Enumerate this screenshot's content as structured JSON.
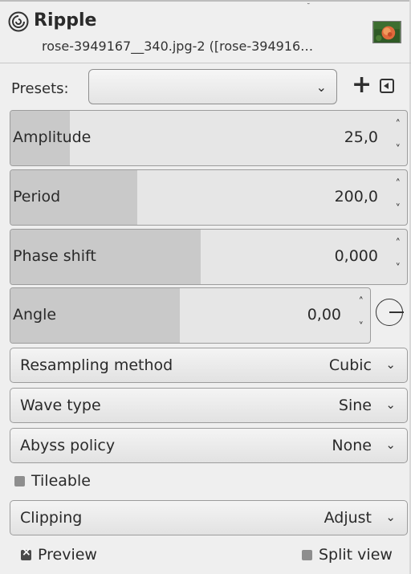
{
  "header": {
    "title": "Ripple",
    "subtitle": "rose-3949167__340.jpg-2 ([rose-394916…",
    "icon": "ripple-swirl-icon",
    "thumbnail": "rose-image-thumbnail"
  },
  "presets": {
    "label": "Presets:",
    "value": "",
    "add_icon": "plus-icon",
    "menu_icon": "menu-triangle-icon"
  },
  "params": {
    "amplitude": {
      "label": "Amplitude",
      "value": "25,0",
      "fill_fraction": 0.15
    },
    "period": {
      "label": "Period",
      "value": "200,0",
      "fill_fraction": 0.32
    },
    "phase_shift": {
      "label": "Phase shift",
      "value": "0,000",
      "fill_fraction": 0.48
    },
    "angle": {
      "label": "Angle",
      "value": "0,00",
      "fill_fraction": 0.47
    }
  },
  "options": {
    "resampling": {
      "label": "Resampling method",
      "value": "Cubic"
    },
    "wave_type": {
      "label": "Wave type",
      "value": "Sine"
    },
    "abyss": {
      "label": "Abyss policy",
      "value": "None"
    },
    "clipping": {
      "label": "Clipping",
      "value": "Adjust"
    }
  },
  "toggles": {
    "tileable": {
      "label": "Tileable",
      "checked": false
    },
    "preview": {
      "label": "Preview",
      "checked": true
    },
    "split_view": {
      "label": "Split view",
      "checked": false
    }
  }
}
